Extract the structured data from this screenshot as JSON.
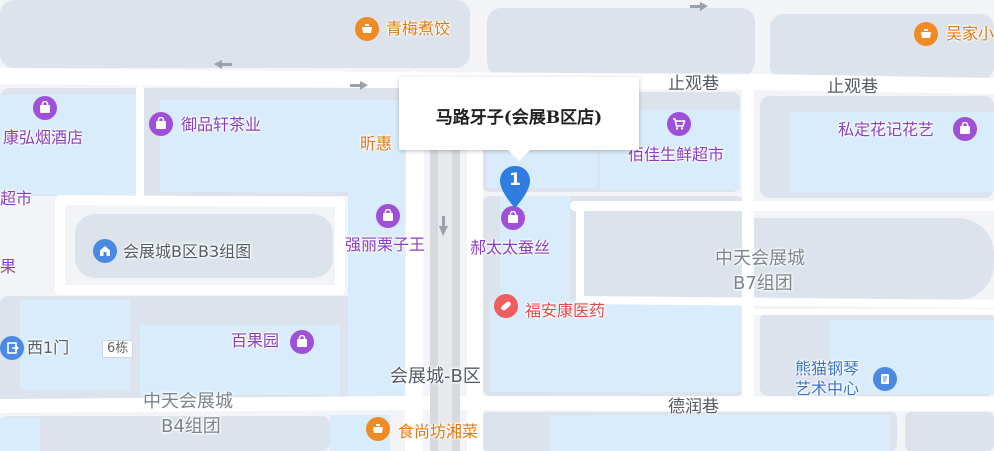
{
  "callout": {
    "title": "马路牙子(会展B区店)",
    "marker_number": "1"
  },
  "pois": {
    "qingmei": "青梅煮饺",
    "wujia": "吴家小",
    "kanghong": "康弘烟酒店",
    "yupin": "御品轩茶业",
    "xinhui": "昕惠",
    "baijia": "佰佳生鲜超市",
    "sidinghua": "私定花记花艺",
    "chaoshi": "超市",
    "qiangli": "强丽栗子王",
    "hetaitai": "郝太太蚕丝",
    "zutu": "会展城B区B3组图",
    "guo": "果",
    "fuan": "福安康医药",
    "xiyimen": "西1门",
    "baiguoyuan": "百果园",
    "xiongmao_line1": "熊猫钢琴",
    "xiongmao_line2": "艺术中心",
    "shishangfang": "食尚坊湘菜"
  },
  "roads": {
    "zhiguan_1": "止观巷",
    "zhiguan_2": "止观巷",
    "derun": "德润巷",
    "huizhan_b": "会展城-B区"
  },
  "areas": {
    "b7_line1": "中天会展城",
    "b7_line2": "B7组团",
    "b4_line1": "中天会展城",
    "b4_line2": "B4组团"
  },
  "badges": {
    "building_6": "6栋"
  },
  "colors": {
    "block_fill": "#dce3ec",
    "road_fill": "#ffffff",
    "accent_purple": "#a050d8",
    "accent_orange": "#f08a22",
    "marker_blue": "#2f7de1"
  }
}
